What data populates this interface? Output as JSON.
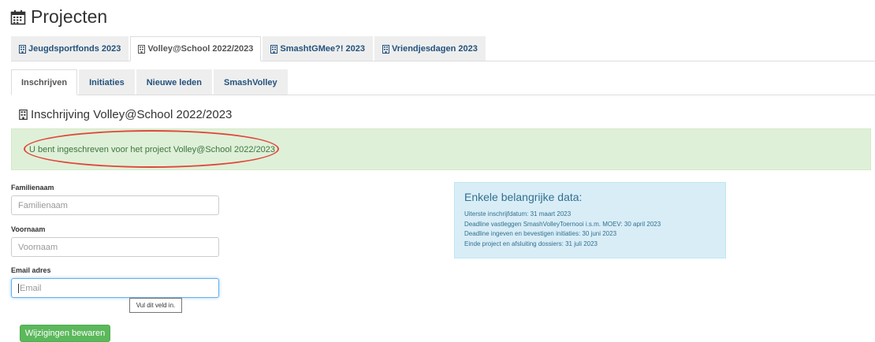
{
  "page": {
    "title": "Projecten",
    "title_icon": "calendar-icon"
  },
  "project_tabs": [
    {
      "label": "Jeugdsportfonds 2023",
      "active": false
    },
    {
      "label": "Volley@School 2022/2023",
      "active": true
    },
    {
      "label": "SmashtGMee?! 2023",
      "active": false
    },
    {
      "label": "Vriendjesdagen 2023",
      "active": false
    }
  ],
  "sub_tabs": [
    {
      "label": "Inschrijven",
      "active": true
    },
    {
      "label": "Initiaties",
      "active": false
    },
    {
      "label": "Nieuwe leden",
      "active": false
    },
    {
      "label": "SmashVolley",
      "active": false
    }
  ],
  "section": {
    "title": "Inschrijving Volley@School 2022/2023"
  },
  "alert": {
    "message": "U bent ingeschreven voor het project Volley@School 2022/2023"
  },
  "form": {
    "familienaam": {
      "label": "Familienaam",
      "placeholder": "Familienaam",
      "value": ""
    },
    "voornaam": {
      "label": "Voornaam",
      "placeholder": "Voornaam",
      "value": ""
    },
    "email": {
      "label": "Email adres",
      "placeholder": "Email",
      "value": ""
    },
    "tooltip": "Vul dit veld in.",
    "submit_label": "Wijzigingen bewaren"
  },
  "info": {
    "title": "Enkele belangrijke data:",
    "lines": [
      "Uiterste inschrijfdatum: 31 maart 2023",
      "Deadline vastleggen SmashVolleyToernooi i.s.m. MOEV: 30 april 2023",
      "Deadline ingeven en bevestigen initiaties: 30 juni 2023",
      "Einde project en afsluiting dossiers: 31 juli 2023"
    ]
  },
  "colors": {
    "link": "#23527c",
    "success_bg": "#dff0d8",
    "info_bg": "#d9edf7",
    "button_green": "#5cb85c",
    "annotation_red": "#e0473b"
  }
}
